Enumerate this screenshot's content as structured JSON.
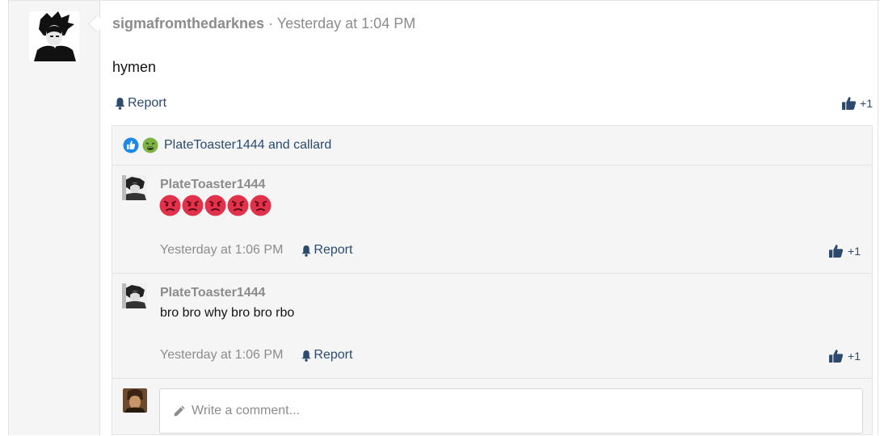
{
  "post": {
    "username": "sigmafromthedarknes",
    "separator": "·",
    "timestamp": "Yesterday at 1:04 PM",
    "body": "hymen",
    "report_label": "Report",
    "like_label": "+1"
  },
  "reactions": {
    "icons": [
      "like-reaction-icon",
      "sick-reaction-icon"
    ],
    "names": "PlateToaster1444 and callard"
  },
  "comments": [
    {
      "username": "PlateToaster1444",
      "emojis": [
        "angry-face-icon",
        "angry-face-icon",
        "angry-face-icon",
        "angry-face-icon",
        "angry-face-icon"
      ],
      "timestamp": "Yesterday at 1:06 PM",
      "report_label": "Report",
      "like_label": "+1"
    },
    {
      "username": "PlateToaster1444",
      "text": "bro bro why bro bro rbo",
      "timestamp": "Yesterday at 1:06 PM",
      "report_label": "Report",
      "like_label": "+1"
    }
  ],
  "composer": {
    "placeholder": "Write a comment..."
  },
  "colors": {
    "link": "#2b4a6e",
    "muted": "#8c8c8c",
    "panel": "#f5f5f5",
    "angry": "#e0324b"
  }
}
